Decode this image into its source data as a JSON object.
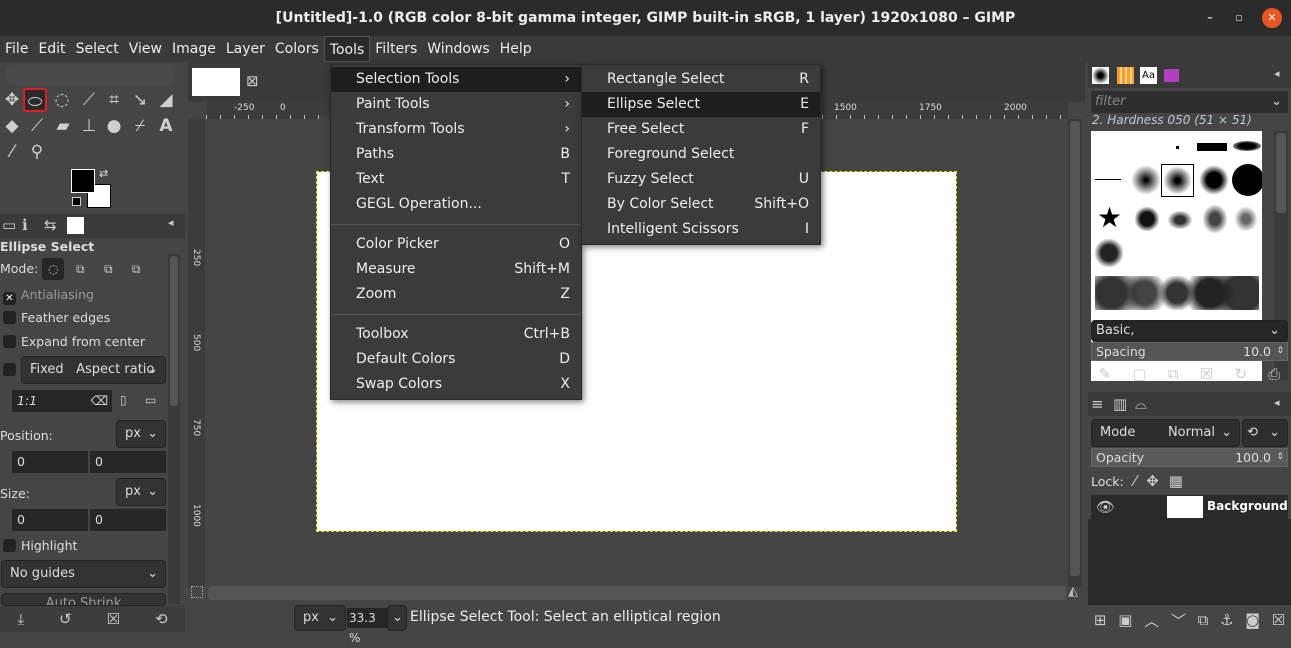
{
  "window": {
    "title": "[Untitled]-1.0 (RGB color 8-bit gamma integer, GIMP built-in sRGB, 1 layer) 1920x1080 – GIMP",
    "minimize": "–",
    "maximize": "▫",
    "close": "✕"
  },
  "menubar": [
    "File",
    "Edit",
    "Select",
    "View",
    "Image",
    "Layer",
    "Colors",
    "Tools",
    "Filters",
    "Windows",
    "Help"
  ],
  "tools_menu": [
    {
      "label": "Selection Tools",
      "accel": "›"
    },
    {
      "label": "Paint Tools",
      "accel": "›"
    },
    {
      "label": "Transform Tools",
      "accel": "›"
    },
    {
      "label": "Paths",
      "accel": "B"
    },
    {
      "label": "Text",
      "accel": "T"
    },
    {
      "label": "GEGL Operation...",
      "accel": ""
    },
    {
      "label": "Color Picker",
      "accel": "O"
    },
    {
      "label": "Measure",
      "accel": "Shift+M"
    },
    {
      "label": "Zoom",
      "accel": "Z"
    },
    {
      "label": "Toolbox",
      "accel": "Ctrl+B"
    },
    {
      "label": "Default Colors",
      "accel": "D"
    },
    {
      "label": "Swap Colors",
      "accel": "X"
    }
  ],
  "selection_submenu": [
    {
      "label": "Rectangle Select",
      "accel": "R"
    },
    {
      "label": "Ellipse Select",
      "accel": "E"
    },
    {
      "label": "Free Select",
      "accel": "F"
    },
    {
      "label": "Foreground Select",
      "accel": ""
    },
    {
      "label": "Fuzzy Select",
      "accel": "U"
    },
    {
      "label": "By Color Select",
      "accel": "Shift+O"
    },
    {
      "label": "Intelligent Scissors",
      "accel": "I"
    }
  ],
  "tool_options": {
    "title": "Ellipse Select",
    "mode_label": "Mode:",
    "antialiasing": "Antialiasing",
    "feather": "Feather edges",
    "expand": "Expand from center",
    "fixed": "Fixed",
    "fixed_option": "Aspect ratio",
    "ratio": "1:1",
    "position_label": "Position:",
    "size_label": "Size:",
    "unit": "px",
    "pos_x": "0",
    "pos_y": "0",
    "size_w": "0",
    "size_h": "0",
    "highlight": "Highlight",
    "guides": "No guides",
    "auto_shrink": "Auto Shrink"
  },
  "rulers": {
    "top": [
      "-250",
      "0",
      "1500",
      "1750",
      "2000"
    ],
    "left": [
      "250",
      "500",
      "750",
      "1000"
    ]
  },
  "image_tab": {
    "close": "⊠"
  },
  "status": {
    "unit": "px",
    "zoom": "33.3 %",
    "message": "Ellipse Select Tool: Select an elliptical region"
  },
  "brushes": {
    "filter_placeholder": "filter",
    "selected": "2. Hardness 050 (51 × 51)",
    "tag": "Basic,",
    "spacing_label": "Spacing",
    "spacing_value": "10.0"
  },
  "layers": {
    "mode_label": "Mode",
    "mode_value": "Normal",
    "opacity_label": "Opacity",
    "opacity_value": "100.0",
    "lock_label": "Lock:",
    "layer_name": "Background"
  },
  "text_tool_glyph": "A"
}
